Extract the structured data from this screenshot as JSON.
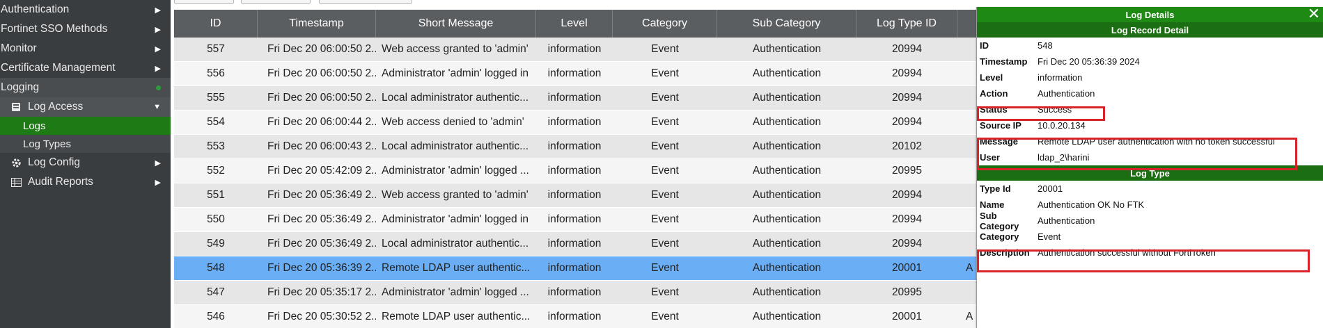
{
  "sidebar": {
    "items": [
      {
        "label": "Authentication",
        "arrow": "▶"
      },
      {
        "label": "Fortinet SSO Methods",
        "arrow": "▶"
      },
      {
        "label": "Monitor",
        "arrow": "▶"
      },
      {
        "label": "Certificate Management",
        "arrow": "▶"
      },
      {
        "label": "Logging"
      }
    ],
    "log_access": {
      "label": "Log Access",
      "icon": "book-icon",
      "arrow": "▼"
    },
    "logs_label": "Logs",
    "log_types_label": "Log Types",
    "log_config": {
      "label": "Log Config",
      "icon": "gear-icon",
      "arrow": "▶"
    },
    "audit_reports": {
      "label": "Audit Reports",
      "icon": "table-icon",
      "arrow": "▶"
    }
  },
  "table": {
    "headers": [
      "ID",
      "Timestamp",
      "Short Message",
      "Level",
      "Category",
      "Sub Category",
      "Log Type ID"
    ],
    "rows": [
      {
        "id": "557",
        "ts": "Fri Dec 20 06:00:50 2...",
        "msg": "Web access granted to 'admin'",
        "level": "information",
        "cat": "Event",
        "sub": "Authentication",
        "ltid": "20994",
        "extra": ""
      },
      {
        "id": "556",
        "ts": "Fri Dec 20 06:00:50 2...",
        "msg": "Administrator 'admin' logged in",
        "level": "information",
        "cat": "Event",
        "sub": "Authentication",
        "ltid": "20994",
        "extra": ""
      },
      {
        "id": "555",
        "ts": "Fri Dec 20 06:00:50 2...",
        "msg": "Local administrator authentic...",
        "level": "information",
        "cat": "Event",
        "sub": "Authentication",
        "ltid": "20994",
        "extra": ""
      },
      {
        "id": "554",
        "ts": "Fri Dec 20 06:00:44 2...",
        "msg": "Web access denied to 'admin'",
        "level": "information",
        "cat": "Event",
        "sub": "Authentication",
        "ltid": "20994",
        "extra": ""
      },
      {
        "id": "553",
        "ts": "Fri Dec 20 06:00:43 2...",
        "msg": "Local administrator authentic...",
        "level": "information",
        "cat": "Event",
        "sub": "Authentication",
        "ltid": "20102",
        "extra": ""
      },
      {
        "id": "552",
        "ts": "Fri Dec 20 05:42:09 2...",
        "msg": "Administrator 'admin' logged ...",
        "level": "information",
        "cat": "Event",
        "sub": "Authentication",
        "ltid": "20995",
        "extra": ""
      },
      {
        "id": "551",
        "ts": "Fri Dec 20 05:36:49 2...",
        "msg": "Web access granted to 'admin'",
        "level": "information",
        "cat": "Event",
        "sub": "Authentication",
        "ltid": "20994",
        "extra": ""
      },
      {
        "id": "550",
        "ts": "Fri Dec 20 05:36:49 2...",
        "msg": "Administrator 'admin' logged in",
        "level": "information",
        "cat": "Event",
        "sub": "Authentication",
        "ltid": "20994",
        "extra": ""
      },
      {
        "id": "549",
        "ts": "Fri Dec 20 05:36:49 2...",
        "msg": "Local administrator authentic...",
        "level": "information",
        "cat": "Event",
        "sub": "Authentication",
        "ltid": "20994",
        "extra": ""
      },
      {
        "id": "548",
        "ts": "Fri Dec 20 05:36:39 2...",
        "msg": "Remote LDAP user authentic...",
        "level": "information",
        "cat": "Event",
        "sub": "Authentication",
        "ltid": "20001",
        "extra": "A",
        "selected": true
      },
      {
        "id": "547",
        "ts": "Fri Dec 20 05:35:17 2...",
        "msg": "Administrator 'admin' logged ...",
        "level": "information",
        "cat": "Event",
        "sub": "Authentication",
        "ltid": "20995",
        "extra": ""
      },
      {
        "id": "546",
        "ts": "Fri Dec 20 05:30:52 2...",
        "msg": "Remote LDAP user authentic...",
        "level": "information",
        "cat": "Event",
        "sub": "Authentication",
        "ltid": "20001",
        "extra": "A"
      }
    ]
  },
  "details": {
    "title": "Log Details",
    "close": "✕",
    "record_section": "Log Record Detail",
    "record": [
      {
        "key": "ID",
        "value": "548"
      },
      {
        "key": "Timestamp",
        "value": "Fri Dec 20 05:36:39 2024"
      },
      {
        "key": "Level",
        "value": "information"
      },
      {
        "key": "Action",
        "value": "Authentication"
      },
      {
        "key": "Status",
        "value": "Success"
      },
      {
        "key": "Source IP",
        "value": "10.0.20.134"
      },
      {
        "key": "Message",
        "value": "Remote LDAP user authentication with no token successful"
      },
      {
        "key": "User",
        "value": "ldap_2\\harini"
      }
    ],
    "type_section": "Log Type",
    "type": [
      {
        "key": "Type Id",
        "value": "20001"
      },
      {
        "key": "Name",
        "value": "Authentication OK No FTK"
      },
      {
        "key": "Sub Category",
        "value": "Authentication"
      },
      {
        "key": "Category",
        "value": "Event"
      },
      {
        "key": "Description",
        "value": "Authentication successful without FortiToken"
      }
    ]
  },
  "colors": {
    "sidebar_bg": "#3a3d40",
    "active_green": "#1e7a14",
    "header_green": "#1e8a14",
    "selected_row": "#6aaef5",
    "highlight_red": "#d8232a"
  }
}
